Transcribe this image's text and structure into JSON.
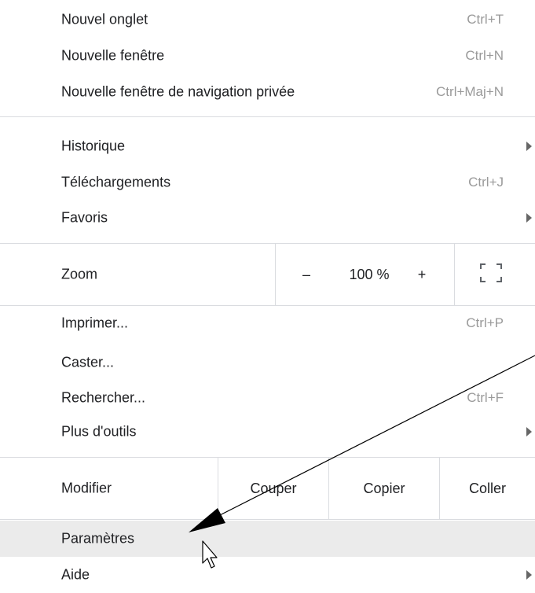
{
  "menu": {
    "new_tab": {
      "label": "Nouvel onglet",
      "shortcut": "Ctrl+T"
    },
    "new_window": {
      "label": "Nouvelle fenêtre",
      "shortcut": "Ctrl+N"
    },
    "new_private": {
      "label": "Nouvelle fenêtre de navigation privée",
      "shortcut": "Ctrl+Maj+N"
    },
    "history": {
      "label": "Historique"
    },
    "downloads": {
      "label": "Téléchargements",
      "shortcut": "Ctrl+J"
    },
    "favorites": {
      "label": "Favoris"
    },
    "zoom": {
      "label": "Zoom",
      "minus": "–",
      "value": "100 %",
      "plus": "+"
    },
    "print": {
      "label": "Imprimer...",
      "shortcut": "Ctrl+P"
    },
    "cast": {
      "label": "Caster..."
    },
    "find": {
      "label": "Rechercher...",
      "shortcut": "Ctrl+F"
    },
    "more_tools": {
      "label": "Plus d'outils"
    },
    "edit": {
      "label": "Modifier",
      "cut": "Couper",
      "copy": "Copier",
      "paste": "Coller"
    },
    "settings": {
      "label": "Paramètres"
    },
    "help": {
      "label": "Aide"
    }
  },
  "icons": {
    "submenu": "chevron-right-icon",
    "fullscreen": "fullscreen-icon",
    "pointer": "mouse-pointer-icon",
    "annotation": "annotation-arrow"
  },
  "colors": {
    "text": "#202124",
    "shortcut": "#9a9a9a",
    "separator": "#dadce0",
    "hover": "#ebebeb"
  }
}
